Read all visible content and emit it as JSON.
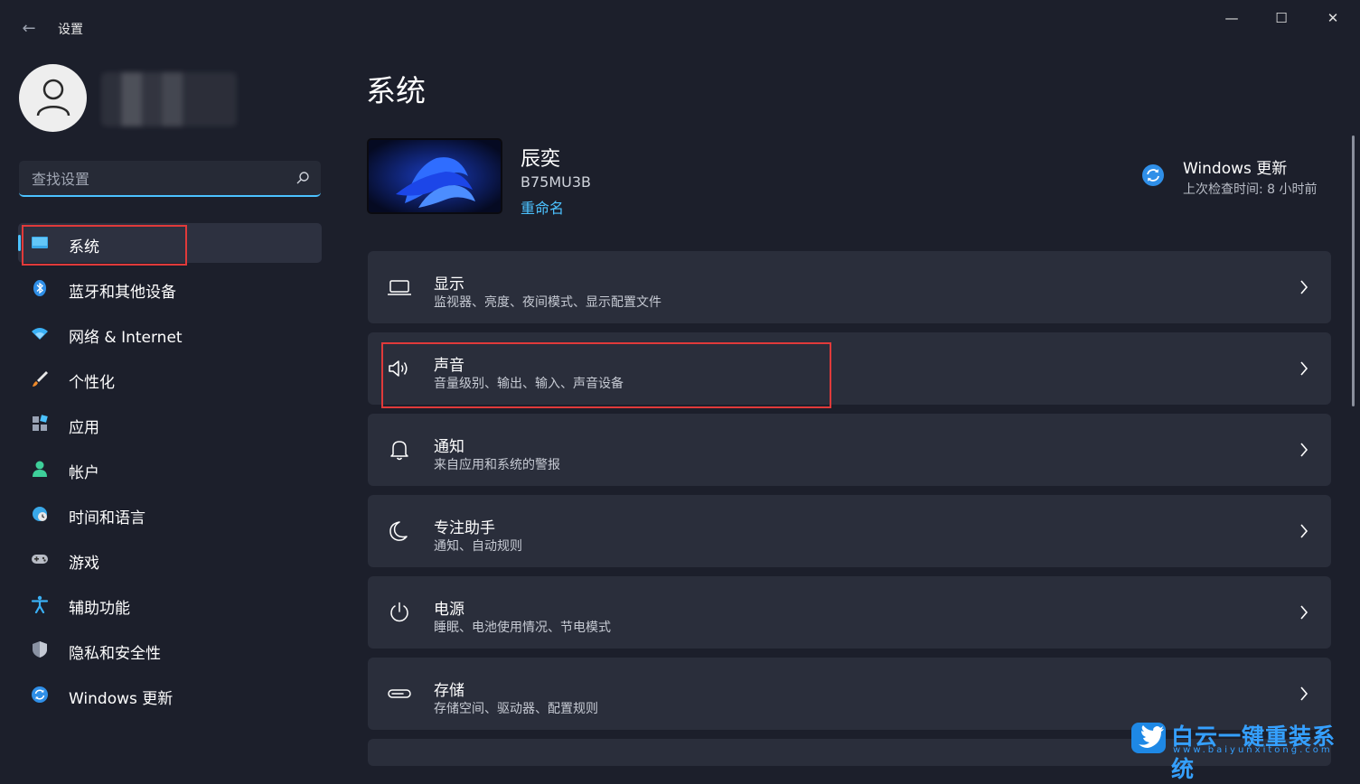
{
  "window": {
    "title": "设置",
    "back_icon": "back-arrow-icon",
    "controls": {
      "minimize": "—",
      "maximize": "☐",
      "close": "✕"
    }
  },
  "sidebar": {
    "search": {
      "placeholder": "查找设置"
    },
    "items": [
      {
        "label": "系统",
        "icon": "monitor-icon",
        "active": true
      },
      {
        "label": "蓝牙和其他设备",
        "icon": "bluetooth-icon"
      },
      {
        "label": "网络 & Internet",
        "icon": "wifi-icon"
      },
      {
        "label": "个性化",
        "icon": "brush-icon"
      },
      {
        "label": "应用",
        "icon": "apps-icon"
      },
      {
        "label": "帐户",
        "icon": "person-icon"
      },
      {
        "label": "时间和语言",
        "icon": "globe-clock-icon"
      },
      {
        "label": "游戏",
        "icon": "gamepad-icon"
      },
      {
        "label": "辅助功能",
        "icon": "accessibility-icon"
      },
      {
        "label": "隐私和安全性",
        "icon": "shield-icon"
      },
      {
        "label": "Windows 更新",
        "icon": "update-icon"
      }
    ]
  },
  "main": {
    "title": "系统",
    "device": {
      "name": "辰奕",
      "model": "B75MU3B",
      "rename": "重命名"
    },
    "update": {
      "title": "Windows 更新",
      "subtitle": "上次检查时间: 8 小时前"
    },
    "cards": [
      {
        "title": "显示",
        "subtitle": "监视器、亮度、夜间模式、显示配置文件",
        "icon": "display-icon"
      },
      {
        "title": "声音",
        "subtitle": "音量级别、输出、输入、声音设备",
        "icon": "speaker-icon"
      },
      {
        "title": "通知",
        "subtitle": "来自应用和系统的警报",
        "icon": "bell-icon"
      },
      {
        "title": "专注助手",
        "subtitle": "通知、自动规则",
        "icon": "moon-icon"
      },
      {
        "title": "电源",
        "subtitle": "睡眠、电池使用情况、节电模式",
        "icon": "power-icon"
      },
      {
        "title": "存储",
        "subtitle": "存储空间、驱动器、配置规则",
        "icon": "storage-icon"
      }
    ]
  },
  "watermark": {
    "text": "白云一键重装系统",
    "url": "www.baiyunxitong.com"
  },
  "colors": {
    "accent": "#4cc2ff",
    "background": "#1c1f2b",
    "card": "#2a2e3b",
    "highlight": "#e03a3a"
  }
}
